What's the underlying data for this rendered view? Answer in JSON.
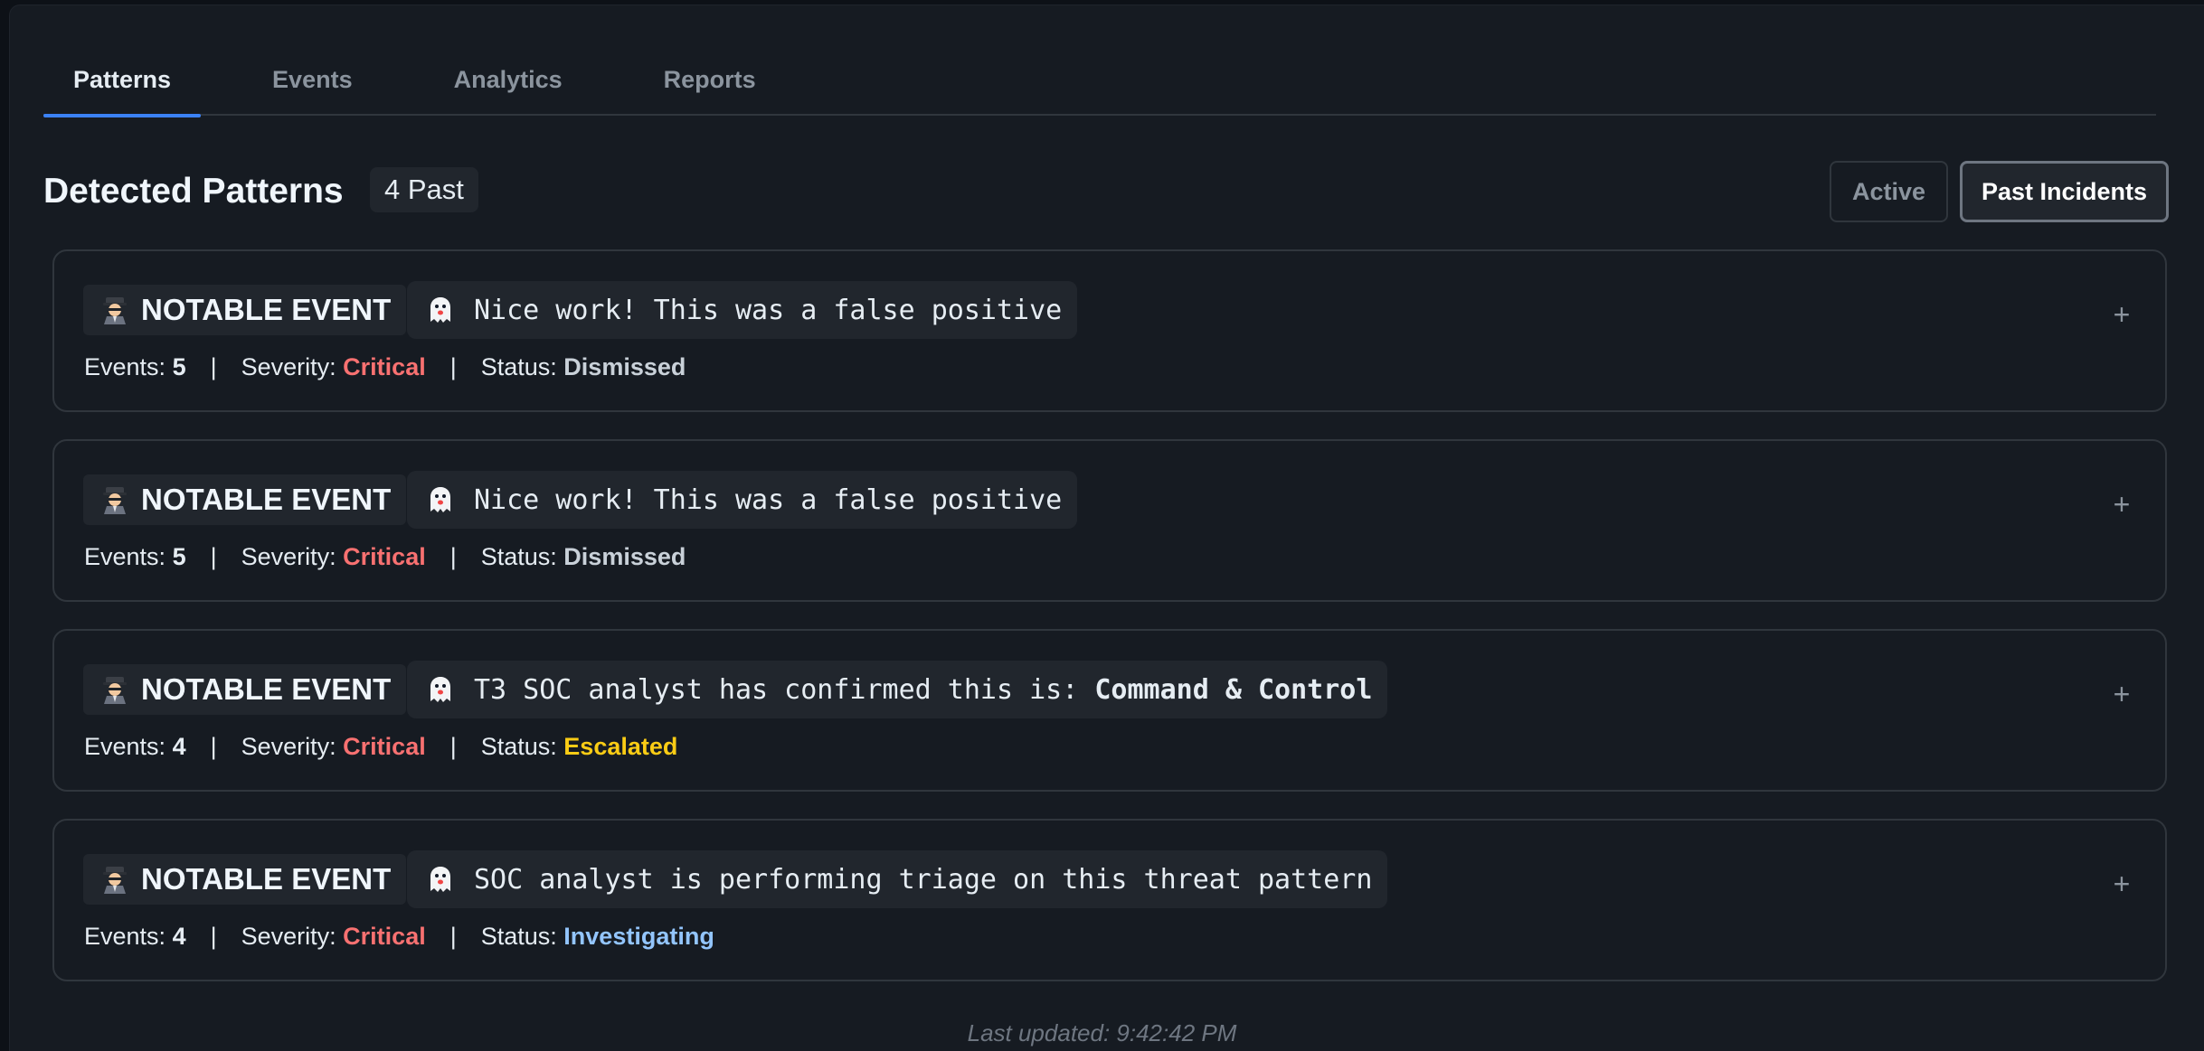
{
  "tabs": [
    {
      "label": "Patterns",
      "active": true
    },
    {
      "label": "Events",
      "active": false
    },
    {
      "label": "Analytics",
      "active": false
    },
    {
      "label": "Reports",
      "active": false
    }
  ],
  "header": {
    "title": "Detected Patterns",
    "count_badge": "4 Past",
    "filters": {
      "active_label": "Active",
      "past_label": "Past Incidents",
      "selected": "Past Incidents"
    }
  },
  "cards": [
    {
      "tag_icon": "detective-icon",
      "tag_label": "NOTABLE EVENT",
      "msg_icon": "ghost-icon",
      "message": "Nice work! This was a false positive",
      "message_emphasis": "",
      "events_label": "Events:",
      "events": "5",
      "severity_label": "Severity:",
      "severity": "Critical",
      "status_label": "Status:",
      "status": "Dismissed"
    },
    {
      "tag_icon": "detective-icon",
      "tag_label": "NOTABLE EVENT",
      "msg_icon": "ghost-icon",
      "message": "Nice work! This was a false positive",
      "message_emphasis": "",
      "events_label": "Events:",
      "events": "5",
      "severity_label": "Severity:",
      "severity": "Critical",
      "status_label": "Status:",
      "status": "Dismissed"
    },
    {
      "tag_icon": "detective-icon",
      "tag_label": "NOTABLE EVENT",
      "msg_icon": "ghost-icon",
      "message": "T3 SOC analyst has confirmed this is: ",
      "message_emphasis": "Command & Control",
      "events_label": "Events:",
      "events": "4",
      "severity_label": "Severity:",
      "severity": "Critical",
      "status_label": "Status:",
      "status": "Escalated"
    },
    {
      "tag_icon": "detective-icon",
      "tag_label": "NOTABLE EVENT",
      "msg_icon": "ghost-icon",
      "message": "SOC analyst is performing triage on this threat pattern",
      "message_emphasis": "",
      "events_label": "Events:",
      "events": "4",
      "severity_label": "Severity:",
      "severity": "Critical",
      "status_label": "Status:",
      "status": "Investigating"
    }
  ],
  "separator": "|",
  "expand_symbol": "+",
  "footer": {
    "last_updated": "Last updated: 9:42:42 PM"
  },
  "colors": {
    "background": "#0d1117",
    "panel": "#161b22",
    "accent": "#3b82f6",
    "critical": "#f87171",
    "escalated": "#facc15",
    "investigating": "#93c5fd"
  }
}
